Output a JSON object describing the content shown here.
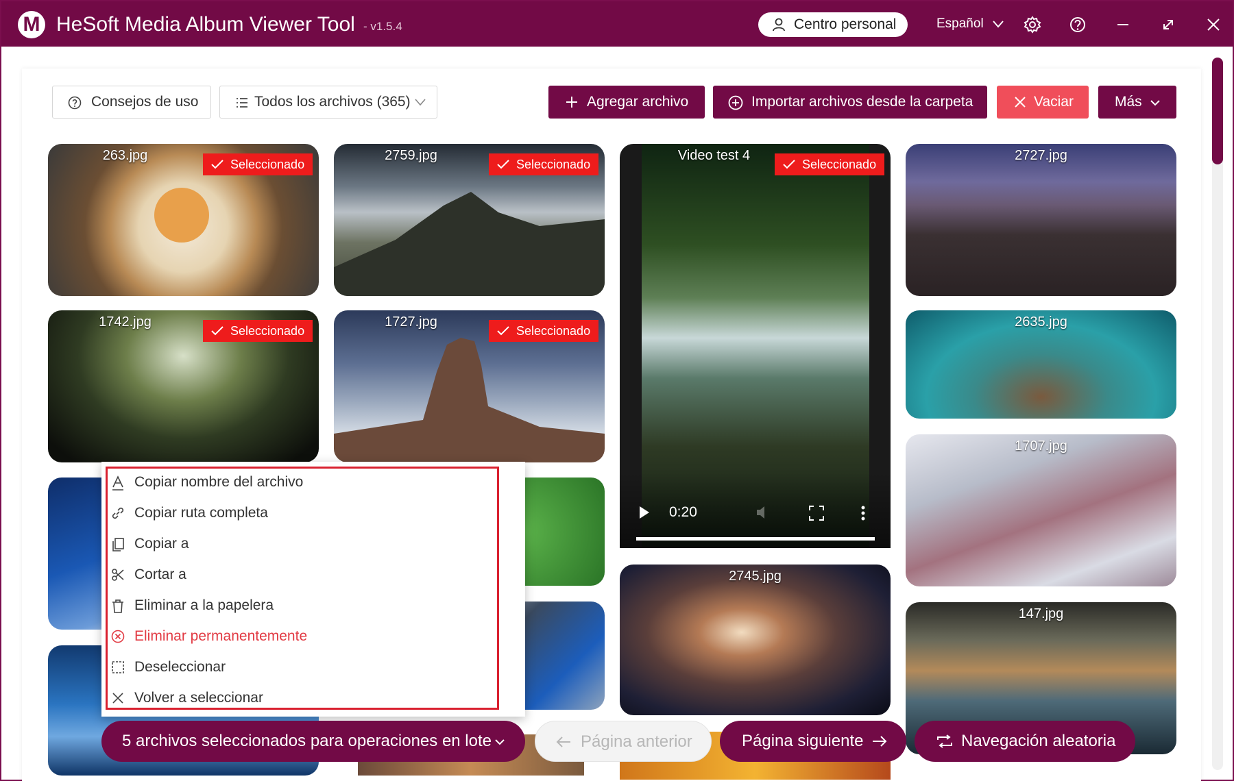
{
  "app": {
    "title": "HeSoft Media Album Viewer Tool",
    "version": "- v1.5.4",
    "logo_letter": "M",
    "personal_center": "Centro personal",
    "language": "Español",
    "accent": "#720a46"
  },
  "toolbar": {
    "tips": "Consejos de uso",
    "all_files": "Todos los archivos (365)",
    "add_file": "Agregar archivo",
    "import_folder": "Importar archivos desde la carpeta",
    "clear": "Vaciar",
    "more": "Más"
  },
  "badge_text": "Seleccionado",
  "tiles": [
    {
      "label": "263.jpg",
      "selected": true
    },
    {
      "label": "2759.jpg",
      "selected": true
    },
    {
      "label": "Video test 4",
      "selected": true
    },
    {
      "label": "2727.jpg",
      "selected": false
    },
    {
      "label": "1742.jpg",
      "selected": true
    },
    {
      "label": "1727.jpg",
      "selected": true
    },
    {
      "label": "2635.jpg",
      "selected": false
    },
    {
      "label": "1707.jpg",
      "selected": false
    },
    {
      "label": "2745.jpg",
      "selected": false
    },
    {
      "label": "147.jpg",
      "selected": false
    }
  ],
  "video": {
    "time": "0:20",
    "progress": 1.0
  },
  "context_menu": [
    {
      "label": "Copiar nombre del archivo",
      "icon": "text-icon"
    },
    {
      "label": "Copiar ruta completa",
      "icon": "link-icon"
    },
    {
      "label": "Copiar a",
      "icon": "copy-icon"
    },
    {
      "label": "Cortar a",
      "icon": "scissors-icon"
    },
    {
      "label": "Eliminar a la papelera",
      "icon": "trash-icon"
    },
    {
      "label": "Eliminar permanentemente",
      "icon": "close-circle-icon"
    },
    {
      "label": "Deseleccionar",
      "icon": "deselect-icon"
    },
    {
      "label": "Volver a seleccionar",
      "icon": "close-icon"
    }
  ],
  "bottom_bar": {
    "batch": "5 archivos seleccionados para operaciones en lote",
    "prev": "Página anterior",
    "next": "Página siguiente",
    "random": "Navegación aleatoria"
  }
}
